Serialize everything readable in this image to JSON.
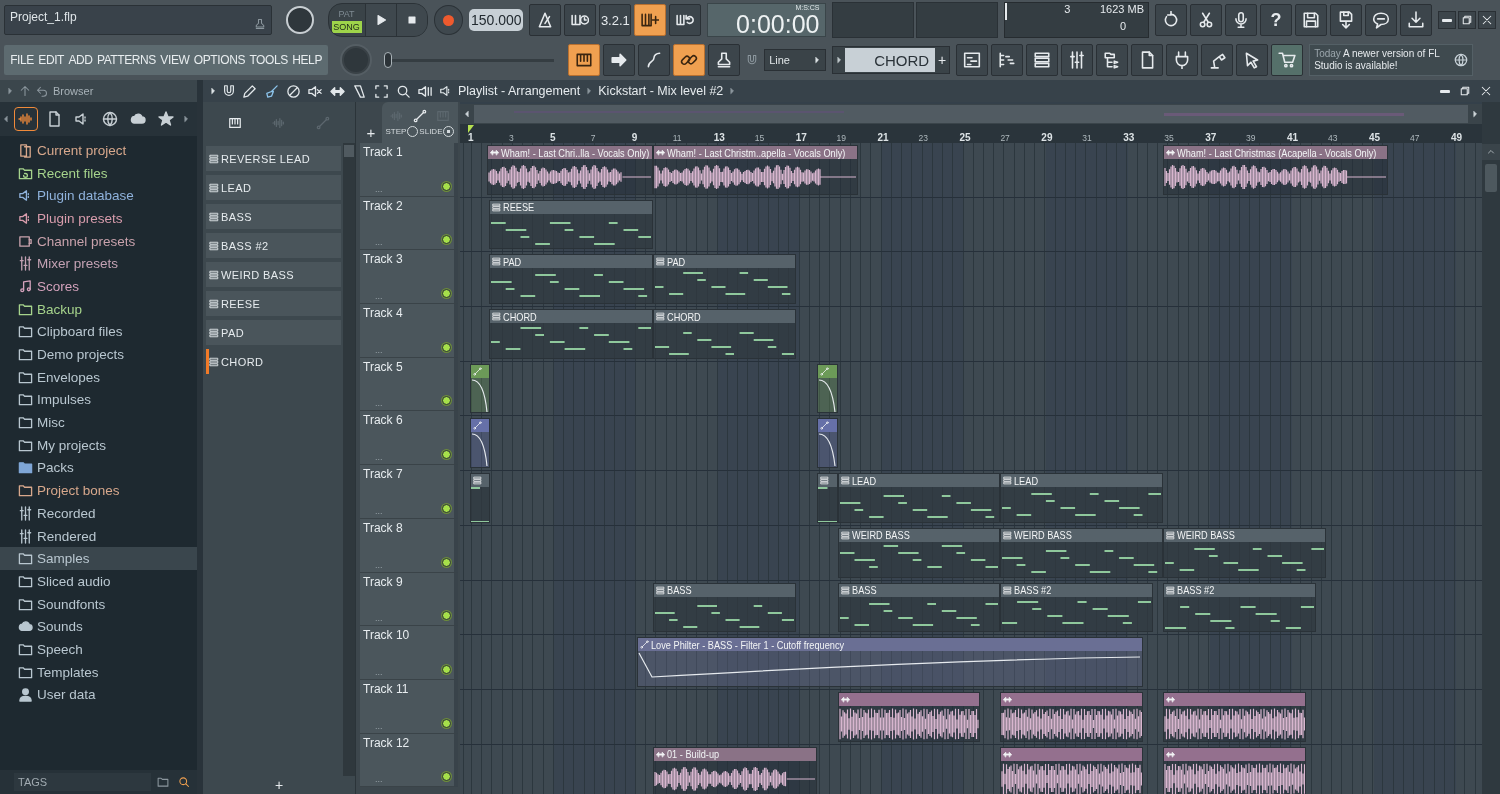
{
  "window": {
    "project_file": "Project_1.flp",
    "controls": [
      {
        "kind": "minimize"
      },
      {
        "kind": "restore"
      },
      {
        "kind": "close"
      }
    ]
  },
  "transport": {
    "modes": [
      {
        "label": "PAT",
        "selected": false
      },
      {
        "label": "SONG",
        "selected": true
      }
    ],
    "tempo": "150.000",
    "time": "0:00:00",
    "time_format": "M:S:CS"
  },
  "top_buttons": [
    {
      "on": false
    },
    {
      "on": false
    },
    {
      "label": "3.2.1",
      "on": false
    },
    {
      "on": true
    },
    {
      "on": false
    }
  ],
  "monitor": {
    "values": [
      "3",
      "1623 MB",
      "0"
    ]
  },
  "tool_buttons_right": [
    {
      "kind": "refresh"
    },
    {
      "kind": "scissors"
    },
    {
      "kind": "mic"
    },
    {
      "kind": "help",
      "label": "?"
    },
    {
      "kind": "save"
    },
    {
      "kind": "export"
    },
    {
      "kind": "chat"
    },
    {
      "kind": "download"
    }
  ],
  "menu": [
    "FILE",
    "EDIT",
    "ADD",
    "PATTERNS",
    "VIEW",
    "OPTIONS",
    "TOOLS",
    "HELP"
  ],
  "tool_buttons": [
    {
      "on": true
    },
    {
      "on": false
    },
    {
      "on": false
    },
    {
      "on": true
    },
    {
      "on": false
    }
  ],
  "master_slider": {
    "level": 0
  },
  "snap": {
    "value": "Line"
  },
  "pattern_selector": {
    "value": "CHORD",
    "add": "+"
  },
  "hint": {
    "when": "Today",
    "text": "A newer version of FL Studio is available!"
  },
  "browser": {
    "title": "Browser",
    "tabs": [
      {
        "selected": true
      },
      {
        "selected": false
      },
      {
        "selected": false
      },
      {
        "selected": false
      },
      {
        "selected": false
      },
      {
        "selected": false
      }
    ],
    "items": [
      {
        "label": "Current project",
        "kind": "project",
        "color": "#d8a88c",
        "selected": false
      },
      {
        "label": "Recent files",
        "kind": "recent",
        "color": "#a6d48c",
        "selected": false
      },
      {
        "label": "Plugin database",
        "kind": "plugin",
        "color": "#8fb2dc",
        "selected": false
      },
      {
        "label": "Plugin presets",
        "kind": "plugin",
        "color": "#d89cac",
        "selected": false
      },
      {
        "label": "Channel presets",
        "kind": "channel",
        "color": "#c9a2ac",
        "selected": false
      },
      {
        "label": "Mixer presets",
        "kind": "mixer",
        "color": "#c4a2b4",
        "selected": false
      },
      {
        "label": "Scores",
        "kind": "score",
        "color": "#d4a2bc",
        "selected": false
      },
      {
        "label": "Backup",
        "kind": "folder",
        "color": "#a6d48c",
        "selected": false
      },
      {
        "label": "Clipboard files",
        "kind": "folder",
        "color": "#b9c7d0",
        "selected": false
      },
      {
        "label": "Demo projects",
        "kind": "folder",
        "color": "#b9c7d0",
        "selected": false
      },
      {
        "label": "Envelopes",
        "kind": "folder",
        "color": "#b9c7d0",
        "selected": false
      },
      {
        "label": "Impulses",
        "kind": "folder",
        "color": "#b9c7d0",
        "selected": false
      },
      {
        "label": "Misc",
        "kind": "folder",
        "color": "#b9c7d0",
        "selected": false
      },
      {
        "label": "My projects",
        "kind": "folder",
        "color": "#b9c7d0",
        "selected": false
      },
      {
        "label": "Packs",
        "kind": "packs",
        "color": "#b9c7d0",
        "selected": false
      },
      {
        "label": "Project bones",
        "kind": "folder",
        "color": "#d8a88c",
        "selected": false
      },
      {
        "label": "Recorded",
        "kind": "mixer",
        "color": "#b9c7d0",
        "selected": false
      },
      {
        "label": "Rendered",
        "kind": "mixer",
        "color": "#b9c7d0",
        "selected": false
      },
      {
        "label": "Samples",
        "kind": "folder",
        "color": "#b9c7d0",
        "selected": true
      },
      {
        "label": "Sliced audio",
        "kind": "folder",
        "color": "#b9c7d0",
        "selected": false
      },
      {
        "label": "Soundfonts",
        "kind": "folder",
        "color": "#b9c7d0",
        "selected": false
      },
      {
        "label": "Sounds",
        "kind": "cloud",
        "color": "#b9c7d0",
        "selected": false
      },
      {
        "label": "Speech",
        "kind": "folder",
        "color": "#b9c7d0",
        "selected": false
      },
      {
        "label": "Templates",
        "kind": "folder",
        "color": "#b9c7d0",
        "selected": false
      },
      {
        "label": "User data",
        "kind": "user",
        "color": "#b9c7d0",
        "selected": false
      }
    ],
    "tags": "TAGS"
  },
  "playlist": {
    "title": "Playlist - Arrangement",
    "arrangement": "Kickstart - Mix level #2",
    "tools": [
      {
        "selected": false
      },
      {
        "selected": true
      },
      {
        "selected": false
      },
      {
        "selected": false
      },
      {
        "selected": false
      },
      {
        "selected": false
      },
      {
        "selected": false
      },
      {
        "selected": false
      },
      {
        "selected": false
      }
    ],
    "patterns": [
      {
        "label": "REVERSE LEAD",
        "selected": false
      },
      {
        "label": "LEAD",
        "selected": false
      },
      {
        "label": "BASS",
        "selected": false
      },
      {
        "label": "BASS #2",
        "selected": false
      },
      {
        "label": "WEIRD BASS",
        "selected": false
      },
      {
        "label": "REESE",
        "selected": false
      },
      {
        "label": "PAD",
        "selected": false
      },
      {
        "label": "CHORD",
        "selected": true
      }
    ],
    "pattern_add": "+",
    "track_add": "+",
    "step_label": "STEP",
    "slide_label": "SLIDE",
    "ruler": [
      "1",
      "3",
      "5",
      "7",
      "9",
      "11",
      "13",
      "15",
      "17",
      "19",
      "21",
      "23",
      "25",
      "27",
      "29",
      "31",
      "33",
      "35",
      "37",
      "39",
      "41",
      "43",
      "45",
      "47",
      "49"
    ],
    "tracks": [
      {
        "name": "Track 1",
        "more": "...",
        "enabled": true,
        "clips": [
          {
            "kind": "audio",
            "label": "Wham! - Last Chri..lla - Vocals Only)",
            "color": "#8a7286"
          },
          {
            "kind": "audio",
            "label": "Wham! - Last Christm..apella - Vocals Only)",
            "color": "#8a7286"
          },
          {
            "kind": "audio",
            "label": "Wham! - Last Christmas (Acapella - Vocals Only)",
            "color": "#8a7286"
          }
        ]
      },
      {
        "name": "Track 2",
        "more": "...",
        "enabled": true,
        "clips": [
          {
            "kind": "pattern",
            "label": "REESE",
            "color": "#56626a"
          }
        ]
      },
      {
        "name": "Track 3",
        "more": "...",
        "enabled": true,
        "clips": [
          {
            "kind": "pattern",
            "label": "PAD",
            "color": "#56626a"
          },
          {
            "kind": "pattern",
            "label": "PAD",
            "color": "#56626a"
          }
        ]
      },
      {
        "name": "Track 4",
        "more": "...",
        "enabled": true,
        "clips": [
          {
            "kind": "pattern",
            "label": "CHORD",
            "color": "#56626a"
          },
          {
            "kind": "pattern",
            "label": "CHORD",
            "color": "#56626a"
          }
        ]
      },
      {
        "name": "Track 5",
        "more": "...",
        "enabled": true,
        "clips": [
          {
            "kind": "automation",
            "color": "#6c9a58"
          },
          {
            "kind": "automation",
            "color": "#6c9a58"
          }
        ]
      },
      {
        "name": "Track 6",
        "more": "...",
        "enabled": true,
        "clips": [
          {
            "kind": "automation",
            "color": "#6670a8"
          },
          {
            "kind": "automation",
            "color": "#6670a8"
          }
        ]
      },
      {
        "name": "Track 7",
        "more": "...",
        "enabled": true,
        "clips": [
          {
            "kind": "pattern",
            "color": "#56626a"
          },
          {
            "kind": "pattern",
            "color": "#56626a"
          },
          {
            "kind": "pattern",
            "label": "LEAD",
            "color": "#56626a"
          },
          {
            "kind": "pattern",
            "label": "LEAD",
            "color": "#56626a"
          }
        ]
      },
      {
        "name": "Track 8",
        "more": "...",
        "enabled": true,
        "clips": [
          {
            "kind": "pattern",
            "label": "WEIRD BASS",
            "color": "#56626a"
          },
          {
            "kind": "pattern",
            "label": "WEIRD BASS",
            "color": "#56626a"
          },
          {
            "kind": "pattern",
            "label": "WEIRD BASS",
            "color": "#56626a"
          }
        ]
      },
      {
        "name": "Track 9",
        "more": "...",
        "enabled": true,
        "clips": [
          {
            "kind": "pattern",
            "label": "BASS",
            "color": "#56626a"
          },
          {
            "kind": "pattern",
            "label": "BASS",
            "color": "#56626a"
          },
          {
            "kind": "pattern",
            "label": "BASS #2",
            "color": "#56626a"
          },
          {
            "kind": "pattern",
            "label": "BASS #2",
            "color": "#56626a"
          }
        ]
      },
      {
        "name": "Track 10",
        "more": "...",
        "enabled": true,
        "clips": [
          {
            "kind": "automation",
            "label": "Love Philter - BASS - Filter 1 - Cutoff frequency",
            "color": "#6a6f94"
          }
        ]
      },
      {
        "name": "Track 11",
        "more": "...",
        "enabled": true,
        "clips": [
          {
            "kind": "audio",
            "color": "#94708e"
          },
          {
            "kind": "audio",
            "color": "#94708e"
          },
          {
            "kind": "audio",
            "color": "#94708e"
          }
        ]
      },
      {
        "name": "Track 12",
        "more": "...",
        "enabled": true,
        "clips": [
          {
            "kind": "audio",
            "label": "01 - Build-up",
            "color": "#8a7286"
          },
          {
            "kind": "audio",
            "color": "#94708e"
          },
          {
            "kind": "audio",
            "color": "#94708e"
          }
        ]
      }
    ]
  }
}
